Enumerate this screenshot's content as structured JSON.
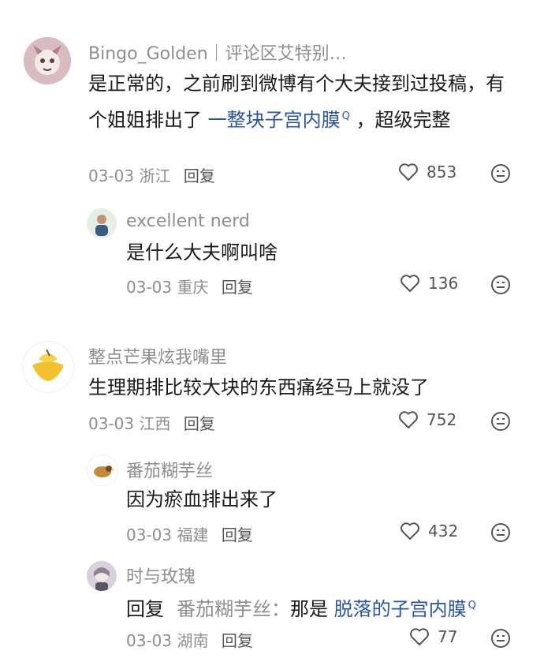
{
  "comments": [
    {
      "author": "Bingo_Golden｜评论区艾特别…",
      "text_before": "是正常的，之前刷到微博有个大夫接到过投稿，有个姐姐排出了 ",
      "link_text": "一整块子宫内膜",
      "text_after": " ，超级完整",
      "date": "03-03",
      "location": "浙江",
      "reply_label": "回复",
      "likes": "853",
      "replies": [
        {
          "author": "excellent nerd",
          "text": "是什么大夫啊叫啥",
          "date": "03-03",
          "location": "重庆",
          "reply_label": "回复",
          "likes": "136"
        }
      ]
    },
    {
      "author": "整点芒果炫我嘴里",
      "text": "生理期排比较大块的东西痛经马上就没了",
      "date": "03-03",
      "location": "江西",
      "reply_label": "回复",
      "likes": "752",
      "replies": [
        {
          "author": "番茄糊芋丝",
          "text": "因为瘀血排出来了",
          "date": "03-03",
          "location": "福建",
          "reply_label": "回复",
          "likes": "432"
        },
        {
          "author": "时与玫瑰",
          "reply_prefix": "回复",
          "reply_target": "番茄糊芋丝：",
          "text_before": "那是 ",
          "link_text": "脱落的子宫内膜",
          "date": "03-03",
          "location": "湖南",
          "reply_label": "回复",
          "likes": "77"
        }
      ]
    }
  ],
  "colors": {
    "link": "#2a55a3",
    "meta": "#8e8e8e",
    "name": "#8e8e8e"
  },
  "icons": {
    "like": "heart-outline-icon",
    "emoji": "emoji-face-icon"
  }
}
